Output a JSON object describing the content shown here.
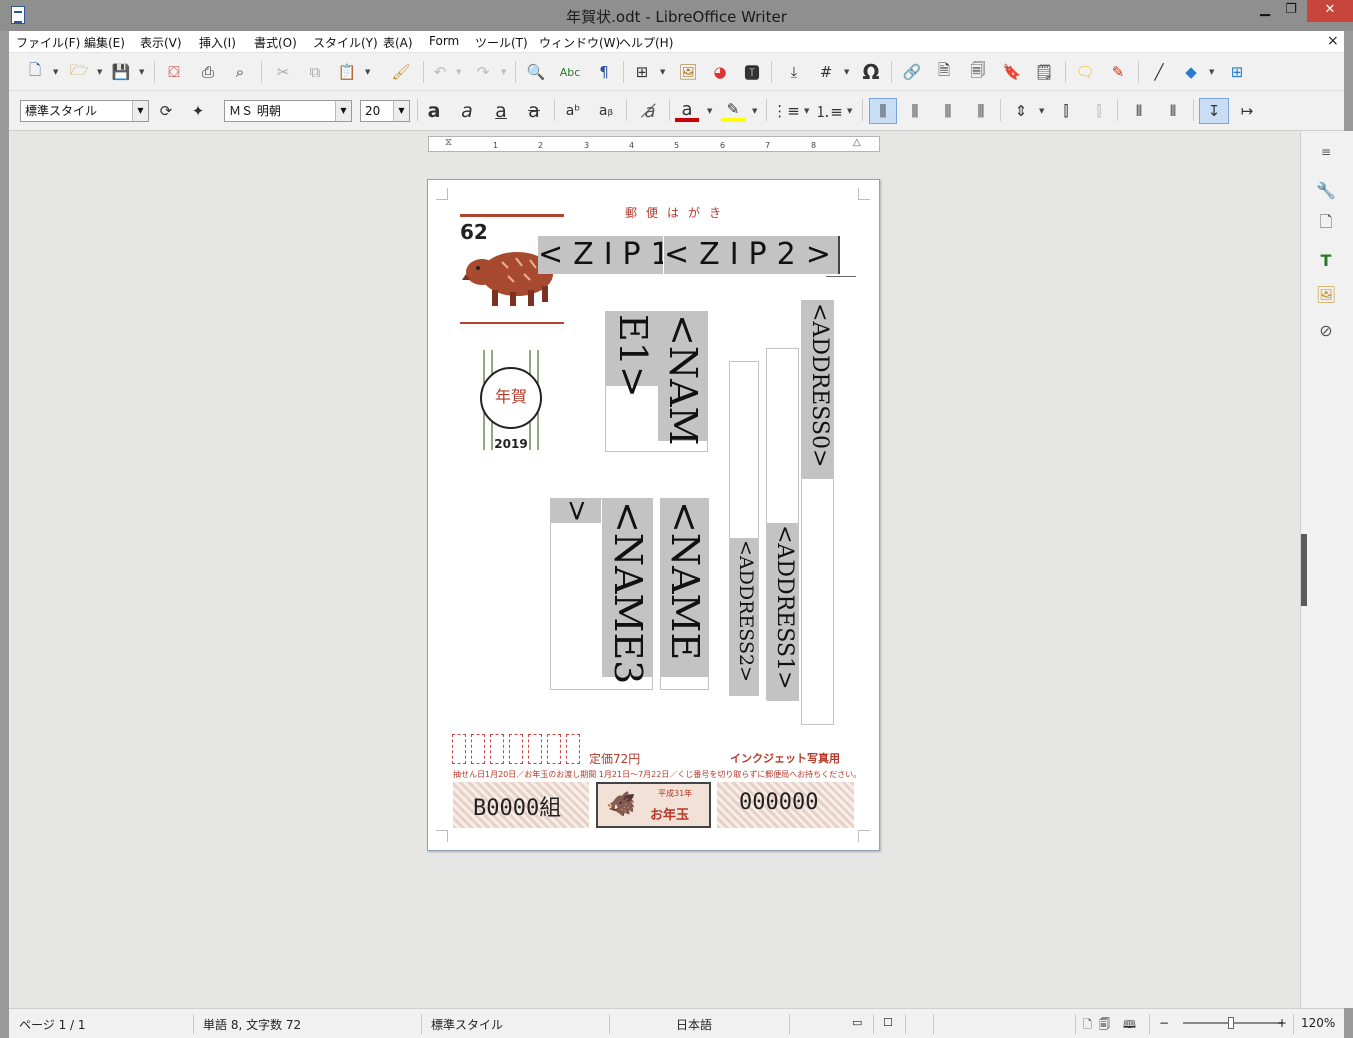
{
  "window": {
    "title": "年賀状.odt - LibreOffice Writer",
    "minimize": "▁",
    "maximize": "❐",
    "close": "✕"
  },
  "menubar": {
    "items": [
      "ファイル(F)",
      "編集(E)",
      "表示(V)",
      "挿入(I)",
      "書式(O)",
      "スタイル(Y)",
      "表(A)",
      "Form",
      "ツール(T)",
      "ウィンドウ(W)",
      "ヘルプ(H)"
    ],
    "doc_close": "×"
  },
  "toolbar2": {
    "paragraph_style": "標準スタイル",
    "font_name": "ＭＳ 明朝",
    "font_size": "20"
  },
  "ruler": {
    "ticks": [
      "1",
      "2",
      "3",
      "4",
      "5",
      "6",
      "7",
      "8"
    ]
  },
  "page": {
    "hagaki_title": "郵便はがき",
    "stamp_value": "62",
    "postmark_year": "2019",
    "postmark_text": "年賀",
    "zip1": "<ZIP1>",
    "zip2": "<ZIP2>",
    "address0": "<ADDRESS0>",
    "address1": "<ADDRESS1>",
    "address2": "<ADDRESS2>",
    "name1_a": "<NAM",
    "name1_b": "E1>",
    "name2": "<NAME",
    "name3": "<NAME3",
    "name3_tail": ">",
    "price": "定価72円",
    "inkjet": "インクジェット写真用",
    "lottery_note": "抽せん日1月20日／お年玉のお渡し期間 1月21日〜7月22日／くじ番号を切り取らずに郵便局へお持ちください。",
    "lottery_group": "B0000組",
    "lottery_center": "お年玉",
    "lottery_center_small": "平成31年",
    "lottery_number": "000000"
  },
  "statusbar": {
    "page": "ページ 1 / 1",
    "words": "単語 8, 文字数 72",
    "style": "標準スタイル",
    "language": "日本語",
    "zoom": "120%"
  },
  "colors": {
    "accent_red": "#b53a2a",
    "field_gray": "#c3c3c3",
    "close_red": "#c7453b"
  }
}
